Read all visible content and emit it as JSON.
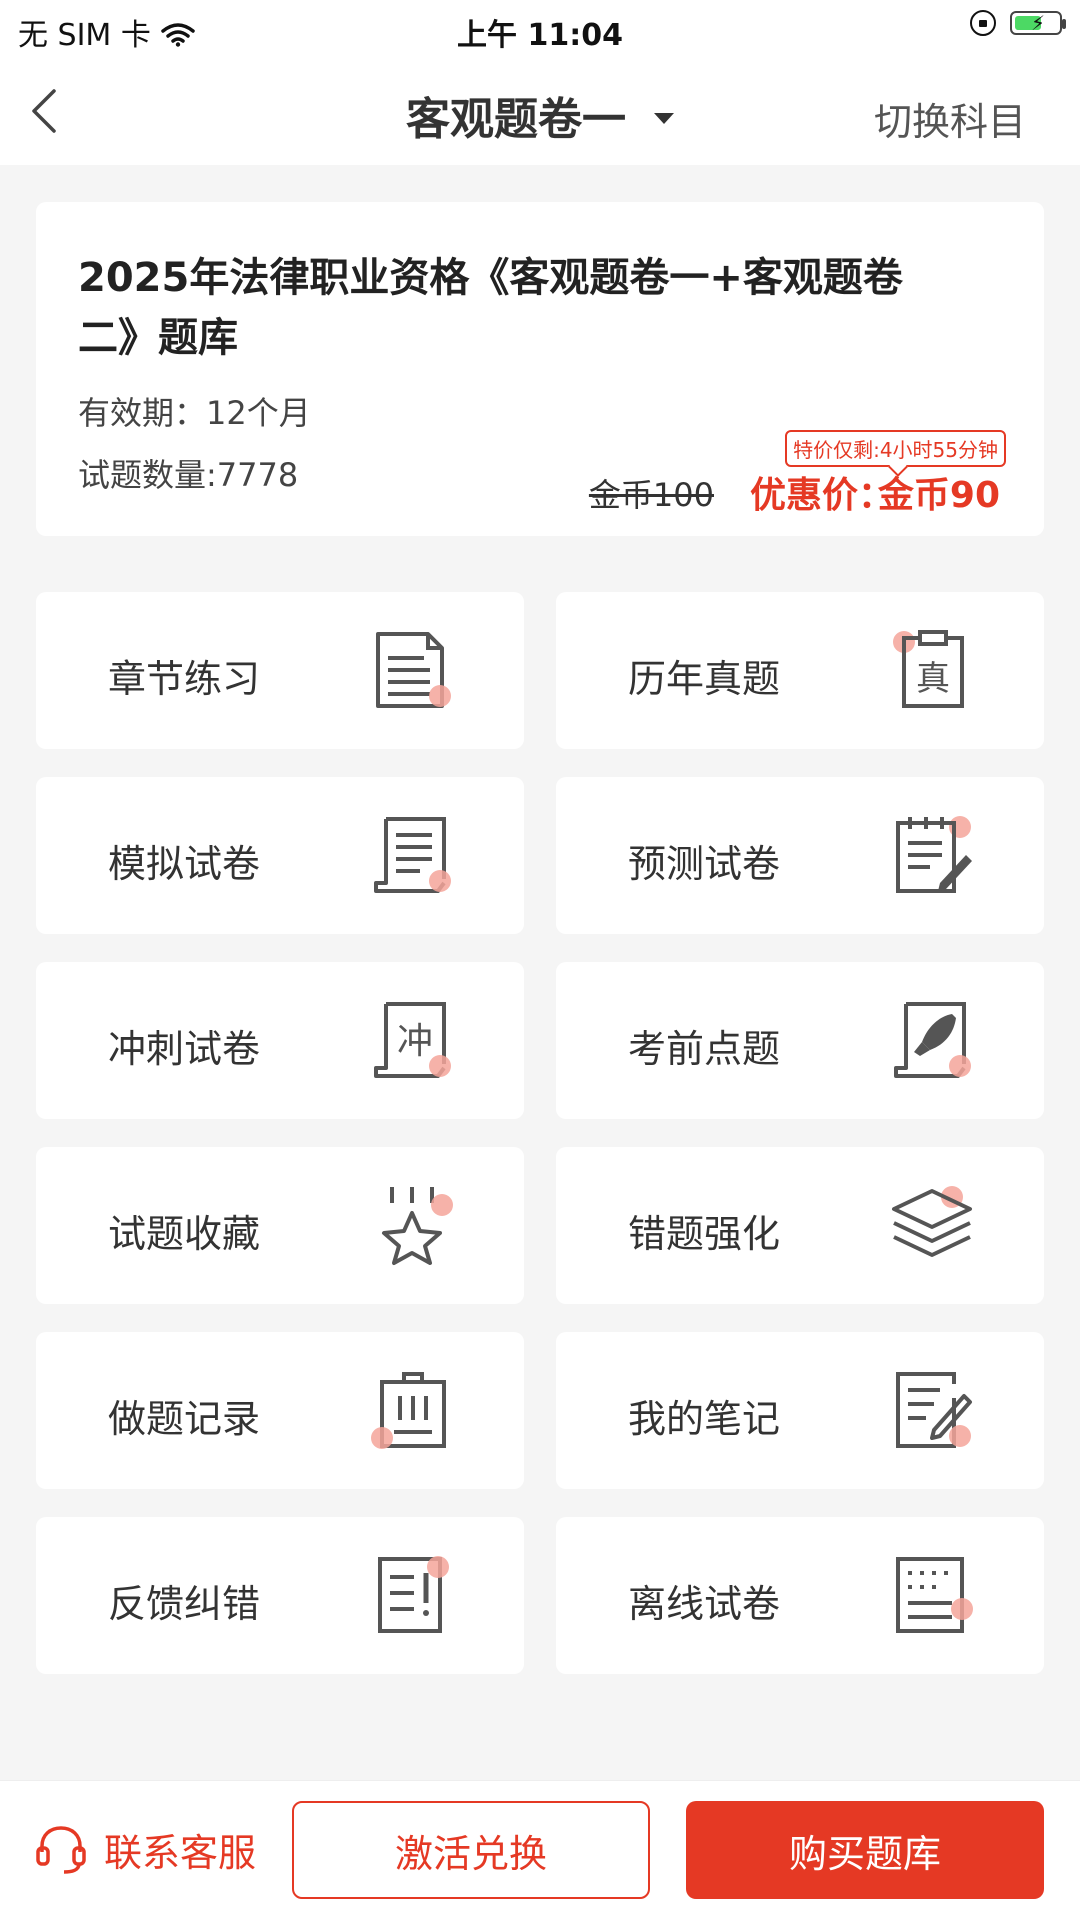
{
  "status_bar": {
    "carrier": "无 SIM 卡",
    "time": "上午 11:04"
  },
  "nav": {
    "title": "客观题卷一",
    "switch_label": "切换科目"
  },
  "course": {
    "title": "2025年法律职业资格《客观题卷一+客观题卷二》题库",
    "validity": "有效期：12个月",
    "question_count": "试题数量:7778",
    "original_price": "金币100",
    "promo_label": "优惠价：",
    "promo_price": "金币90",
    "countdown": "特价仅剩:4小时55分钟"
  },
  "tiles": [
    {
      "label": "章节练习",
      "icon": "document-icon"
    },
    {
      "label": "历年真题",
      "icon": "clipboard-zhen-icon"
    },
    {
      "label": "模拟试卷",
      "icon": "scroll-paper-icon"
    },
    {
      "label": "预测试卷",
      "icon": "notepad-pen-icon"
    },
    {
      "label": "冲刺试卷",
      "icon": "scroll-chong-icon"
    },
    {
      "label": "考前点题",
      "icon": "scroll-rocket-icon"
    },
    {
      "label": "试题收藏",
      "icon": "star-icon"
    },
    {
      "label": "错题强化",
      "icon": "layers-icon"
    },
    {
      "label": "做题记录",
      "icon": "clipboard-list-icon"
    },
    {
      "label": "我的笔记",
      "icon": "note-pencil-icon"
    },
    {
      "label": "反馈纠错",
      "icon": "report-icon"
    },
    {
      "label": "离线试卷",
      "icon": "offline-paper-icon"
    }
  ],
  "bottom": {
    "customer_service": "联系客服",
    "activate": "激活兑换",
    "buy": "购买题库"
  },
  "colors": {
    "accent": "#e53924",
    "icon_dot": "#f4a59a",
    "icon_stroke": "#555555"
  }
}
